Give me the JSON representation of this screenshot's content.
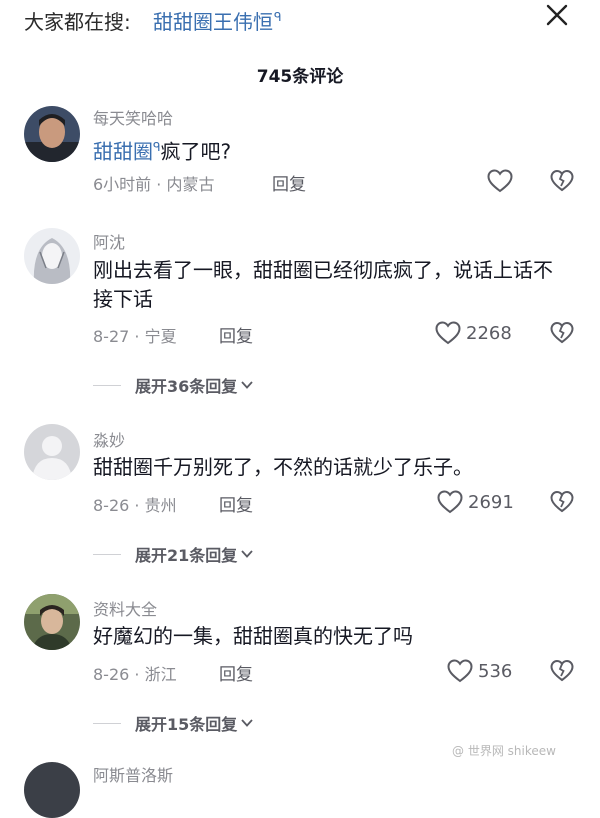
{
  "search": {
    "prefix": "大家都在搜:",
    "term": "甜甜圈王伟恒",
    "search_glyph": "ᑫ"
  },
  "header": {
    "comment_count": "745条评论"
  },
  "comments": [
    {
      "username": "每天笑哈哈",
      "highlight": "甜甜圈",
      "text_suffix": "疯了吧?",
      "time_location": "6小时前 · 内蒙古",
      "reply_label": "回复",
      "likes": ""
    },
    {
      "username": "阿沈",
      "text": "刚出去看了一眼，甜甜圈已经彻底疯了，说话上话不接下话",
      "time_location": "8-27 · 宁夏",
      "reply_label": "回复",
      "likes": "2268",
      "expand_label": "展开36条回复"
    },
    {
      "username": "淼妙",
      "text": "甜甜圈千万别死了，不然的话就少了乐子。",
      "time_location": "8-26 · 贵州",
      "reply_label": "回复",
      "likes": "2691",
      "expand_label": "展开21条回复"
    },
    {
      "username": "资料大全",
      "text": "好魔幻的一集，甜甜圈真的快无了吗",
      "time_location": "8-26 · 浙江",
      "reply_label": "回复",
      "likes": "536",
      "expand_label": "展开15条回复"
    },
    {
      "username": "阿斯普洛斯"
    }
  ],
  "watermark": "@ 世界网 shikeew",
  "colors": {
    "link_blue": "#3a6fb0",
    "meta_gray": "#8a8b91",
    "text": "#161823"
  }
}
